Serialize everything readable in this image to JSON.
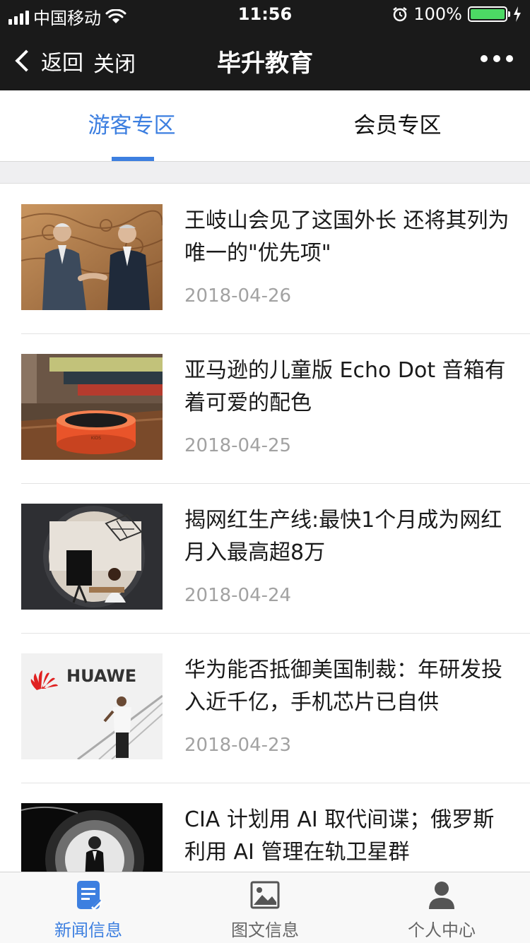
{
  "status_bar": {
    "carrier": "中国移动",
    "time": "11:56",
    "battery": "100%"
  },
  "nav": {
    "back_label": "返回",
    "close_label": "关闭",
    "title": "毕升教育"
  },
  "tabs": [
    {
      "label": "游客专区",
      "active": true
    },
    {
      "label": "会员专区",
      "active": false
    }
  ],
  "news": [
    {
      "title": "王岐山会见了这国外长 还将其列为唯一的\"优先项\"",
      "date": "2018-04-26"
    },
    {
      "title": "亚马逊的儿童版 Echo Dot 音箱有着可爱的配色",
      "date": "2018-04-25"
    },
    {
      "title": "揭网红生产线:最快1个月成为网红 月入最高超8万",
      "date": "2018-04-24"
    },
    {
      "title": "华为能否抵御美国制裁：年研发投入近千亿，手机芯片已自供",
      "date": "2018-04-23"
    },
    {
      "title": "CIA 计划用 AI 取代间谍；俄罗斯利用 AI 管理在轨卫星群",
      "date": ""
    }
  ],
  "thumb_texts": {
    "huawei_logo": "HUAWE"
  },
  "tab_bar": [
    {
      "label": "新闻信息",
      "icon": "news-icon",
      "active": true
    },
    {
      "label": "图文信息",
      "icon": "image-icon",
      "active": false
    },
    {
      "label": "个人中心",
      "icon": "person-icon",
      "active": false
    }
  ],
  "colors": {
    "accent": "#3d7fe0",
    "nav_bg": "#1a1a1a",
    "battery": "#4cd964"
  }
}
